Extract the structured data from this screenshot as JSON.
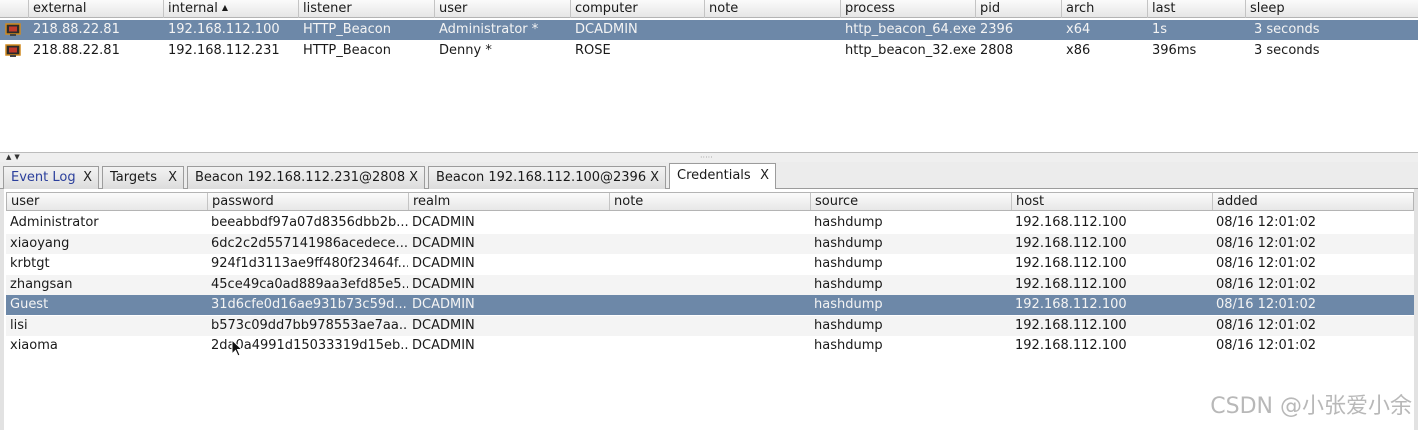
{
  "beacons": {
    "columns": [
      "external",
      "internal",
      "listener",
      "user",
      "computer",
      "note",
      "process",
      "pid",
      "arch",
      "last",
      "sleep"
    ],
    "sort_indicator": "▲",
    "rows": [
      {
        "external": "218.88.22.81",
        "internal": "192.168.112.100",
        "listener": "HTTP_Beacon",
        "user": "Administrator *",
        "computer": "DCADMIN",
        "note": "",
        "process": "http_beacon_64.exe",
        "pid": "2396",
        "arch": "x64",
        "last": "1s",
        "sleep": "3 seconds",
        "selected": true
      },
      {
        "external": "218.88.22.81",
        "internal": "192.168.112.231",
        "listener": "HTTP_Beacon",
        "user": "Denny *",
        "computer": "ROSE",
        "note": "",
        "process": "http_beacon_32.exe",
        "pid": "2808",
        "arch": "x86",
        "last": "396ms",
        "sleep": "3 seconds",
        "selected": false
      }
    ]
  },
  "splitter": {
    "arrows": "▲▼",
    "grip": "·····"
  },
  "tabs": [
    {
      "label": "Event Log",
      "close": "X"
    },
    {
      "label": "Targets",
      "close": "X"
    },
    {
      "label": "Beacon 192.168.112.231@2808",
      "close": "X"
    },
    {
      "label": "Beacon 192.168.112.100@2396",
      "close": "X"
    },
    {
      "label": "Credentials",
      "close": "X",
      "active": true
    }
  ],
  "credentials": {
    "columns": [
      "user",
      "password",
      "realm",
      "note",
      "source",
      "host",
      "added"
    ],
    "rows": [
      {
        "user": "Administrator",
        "password": "beeabbdf97a07d8356dbb2b...",
        "realm": "DCADMIN",
        "note": "",
        "source": "hashdump",
        "host": "192.168.112.100",
        "added": "08/16 12:01:02"
      },
      {
        "user": "xiaoyang",
        "password": "6dc2c2d557141986acedece...",
        "realm": "DCADMIN",
        "note": "",
        "source": "hashdump",
        "host": "192.168.112.100",
        "added": "08/16 12:01:02"
      },
      {
        "user": "krbtgt",
        "password": "924f1d3113ae9ff480f23464f...",
        "realm": "DCADMIN",
        "note": "",
        "source": "hashdump",
        "host": "192.168.112.100",
        "added": "08/16 12:01:02"
      },
      {
        "user": "zhangsan",
        "password": "45ce49ca0ad889aa3efd85e5...",
        "realm": "DCADMIN",
        "note": "",
        "source": "hashdump",
        "host": "192.168.112.100",
        "added": "08/16 12:01:02"
      },
      {
        "user": "Guest",
        "password": "31d6cfe0d16ae931b73c59d...",
        "realm": "DCADMIN",
        "note": "",
        "source": "hashdump",
        "host": "192.168.112.100",
        "added": "08/16 12:01:02",
        "selected": true
      },
      {
        "user": "lisi",
        "password": "b573c09dd7bb978553ae7aa...",
        "realm": "DCADMIN",
        "note": "",
        "source": "hashdump",
        "host": "192.168.112.100",
        "added": "08/16 12:01:02"
      },
      {
        "user": "xiaoma",
        "password": "2da0a4991d15033319d15eb...",
        "realm": "DCADMIN",
        "note": "",
        "source": "hashdump",
        "host": "192.168.112.100",
        "added": "08/16 12:01:02"
      }
    ]
  },
  "watermark": "CSDN @小张爱小余",
  "colors": {
    "selection": "#6d88a8",
    "event_log_tab": "#2b3f9c"
  }
}
